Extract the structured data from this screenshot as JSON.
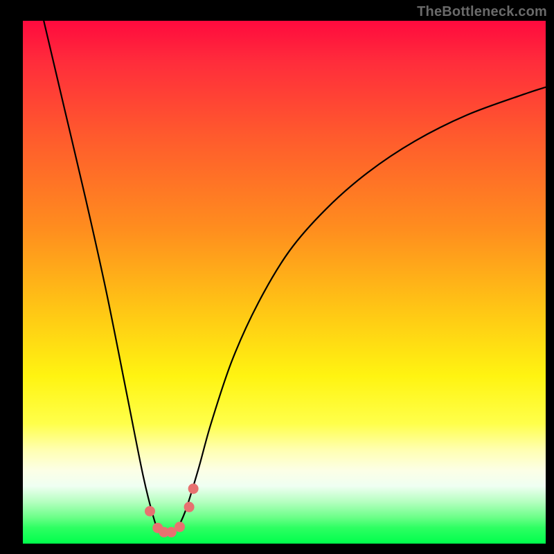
{
  "watermark": "TheBottleneck.com",
  "chart_data": {
    "type": "line",
    "title": "",
    "xlabel": "",
    "ylabel": "",
    "xlim": [
      0,
      1
    ],
    "ylim": [
      0,
      1
    ],
    "series": [
      {
        "name": "curve",
        "x": [
          0.04,
          0.08,
          0.12,
          0.16,
          0.2,
          0.23,
          0.25,
          0.262,
          0.275,
          0.29,
          0.31,
          0.335,
          0.36,
          0.4,
          0.45,
          0.51,
          0.58,
          0.66,
          0.75,
          0.85,
          0.96,
          1.0
        ],
        "y": [
          1.0,
          0.83,
          0.66,
          0.48,
          0.28,
          0.13,
          0.05,
          0.02,
          0.018,
          0.022,
          0.06,
          0.14,
          0.23,
          0.35,
          0.46,
          0.56,
          0.64,
          0.71,
          0.77,
          0.82,
          0.86,
          0.873
        ]
      }
    ],
    "markers": [
      {
        "x": 0.243,
        "y": 0.062
      },
      {
        "x": 0.258,
        "y": 0.03
      },
      {
        "x": 0.27,
        "y": 0.022
      },
      {
        "x": 0.284,
        "y": 0.022
      },
      {
        "x": 0.3,
        "y": 0.032
      },
      {
        "x": 0.318,
        "y": 0.07
      },
      {
        "x": 0.326,
        "y": 0.105
      }
    ],
    "marker_color": "#e77170",
    "curve_color": "#000000"
  }
}
